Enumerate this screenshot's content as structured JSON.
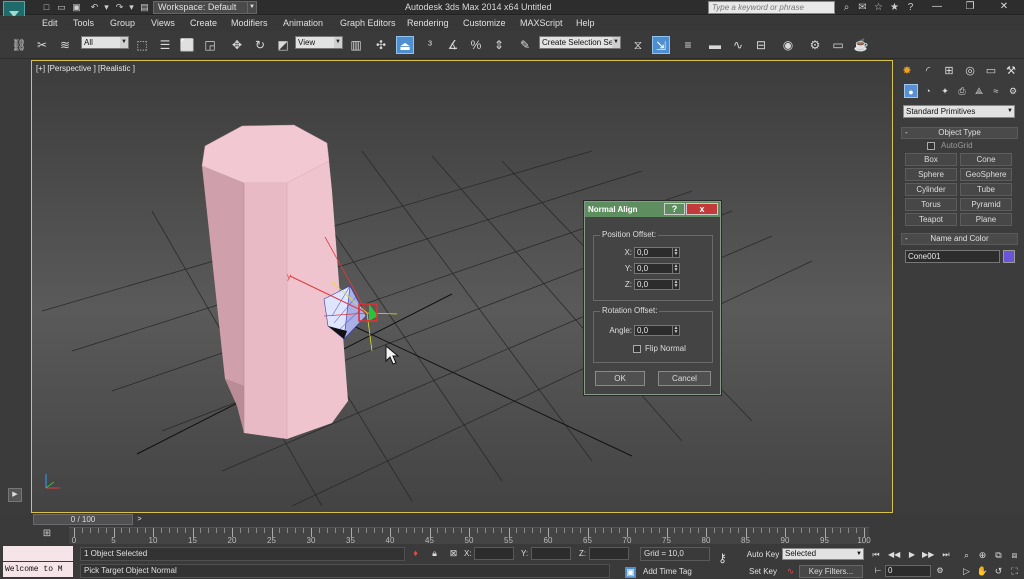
{
  "app_title": "Autodesk 3ds Max  2014 x64",
  "doc_title": "Untitled",
  "workspace": {
    "label": "Workspace: Default"
  },
  "help_search": {
    "placeholder": "Type a keyword or phrase"
  },
  "menu": [
    "Edit",
    "Tools",
    "Group",
    "Views",
    "Create",
    "Modifiers",
    "Animation",
    "Graph Editors",
    "Rendering",
    "Customize",
    "MAXScript",
    "Help"
  ],
  "toolbar": {
    "filter": "All",
    "ref_coord": "View",
    "named_selection": "Create Selection Se"
  },
  "viewport": {
    "label": "[+] [Perspective ] [Realistic ]"
  },
  "dialog": {
    "title": "Normal Align",
    "position_group": "Position Offset:",
    "x_label": "X:",
    "x_value": "0,0",
    "y_label": "Y:",
    "y_value": "0,0",
    "z_label": "Z:",
    "z_value": "0,0",
    "rotation_group": "Rotation Offset:",
    "angle_label": "Angle:",
    "angle_value": "0,0",
    "flip_label": "Flip Normal",
    "ok": "OK",
    "cancel": "Cancel",
    "help_btn": "?",
    "close_btn": "x"
  },
  "command_panel": {
    "category": "Standard Primitives",
    "object_type_title": "Object Type",
    "autogrid": "AutoGrid",
    "primitives": [
      "Box",
      "Cone",
      "Sphere",
      "GeoSphere",
      "Cylinder",
      "Tube",
      "Torus",
      "Pyramid",
      "Teapot",
      "Plane"
    ],
    "name_color_title": "Name and Color",
    "object_name": "Cone001",
    "object_color": "#6a54d8"
  },
  "timeline": {
    "slider": "0 / 100",
    "ticks": [
      0,
      5,
      10,
      15,
      20,
      25,
      30,
      35,
      40,
      45,
      50,
      55,
      60,
      65,
      70,
      75,
      80,
      85,
      90,
      95,
      100
    ]
  },
  "status": {
    "listener": "Welcome to M",
    "selection": "1 Object Selected",
    "prompt": "Pick Target Object Normal",
    "x": "X:",
    "y": "Y:",
    "z": "Z:",
    "grid": "Grid = 10,0",
    "add_time_tag": "Add Time Tag",
    "auto_key": "Auto Key",
    "set_key": "Set Key",
    "key_mode": "Selected",
    "key_filters": "Key Filters...",
    "frame": "0"
  },
  "colors": {
    "accent": "#4f8fcf",
    "dialog_title": "#5e8d60",
    "viewport_border": "#d8c24a",
    "object": "#e7bcc7"
  }
}
